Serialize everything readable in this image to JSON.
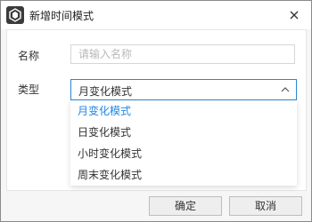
{
  "window": {
    "title": "新增时间模式",
    "app_icon": "hexagon-logo-icon",
    "close_icon": "close-icon"
  },
  "form": {
    "name_label": "名称",
    "name_value": "",
    "name_placeholder": "请输入名称",
    "type_label": "类型",
    "type_selected": "月变化模式",
    "type_options": [
      "月变化模式",
      "日变化模式",
      "小时变化模式",
      "周末变化模式"
    ]
  },
  "buttons": {
    "ok": "确定",
    "cancel": "取消"
  },
  "colors": {
    "accent": "#1e88e5",
    "focus_border": "#2a86d5"
  }
}
